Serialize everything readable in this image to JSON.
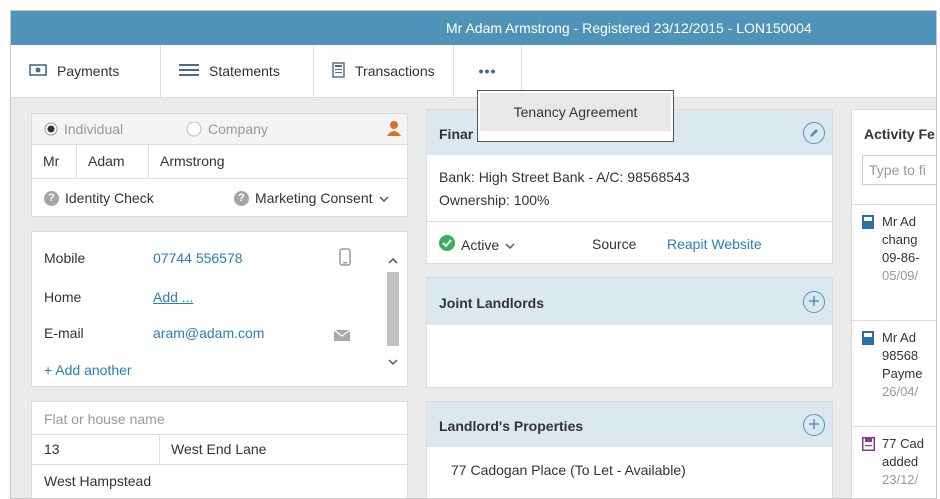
{
  "header": {
    "title": "Mr Adam Armstrong - Registered 23/12/2015 - LON150004"
  },
  "toolbar": {
    "payments": "Payments",
    "statements": "Statements",
    "transactions": "Transactions",
    "more": "•••"
  },
  "dropdown": {
    "item": "Tenancy Agreement"
  },
  "contact": {
    "individual": "Individual",
    "company": "Company",
    "title": "Mr",
    "first": "Adam",
    "last": "Armstrong",
    "identity": "Identity Check",
    "marketing": "Marketing Consent"
  },
  "phones": {
    "mobile_label": "Mobile",
    "mobile_value": "07744 556578",
    "home_label": "Home",
    "home_value": "Add ...",
    "email_label": "E-mail",
    "email_value": "aram@adam.com",
    "add_another": "+ Add another"
  },
  "address": {
    "placeholder": "Flat or house name",
    "number": "13",
    "street": "West End Lane",
    "area": "West Hampstead"
  },
  "financial": {
    "title": "Finar",
    "bank": "Bank: High Street Bank - A/C: 98568543",
    "ownership": "Ownership: 100%",
    "status": "Active",
    "source_label": "Source",
    "source_value": "Reapit Website"
  },
  "joint": {
    "title": "Joint Landlords"
  },
  "properties": {
    "title": "Landlord's Properties",
    "item": "77 Cadogan Place (To Let - Available)"
  },
  "activity": {
    "title": "Activity Fe",
    "filter_placeholder": "Type to fi",
    "entries": [
      {
        "lines": [
          "Mr Ad",
          "chang",
          "09-86-"
        ],
        "date": "05/09/"
      },
      {
        "lines": [
          "Mr Ad",
          "98568",
          "Payme"
        ],
        "date": "26/04/"
      },
      {
        "lines": [
          "77 Cad",
          "added"
        ],
        "date": "23/12/"
      }
    ]
  }
}
